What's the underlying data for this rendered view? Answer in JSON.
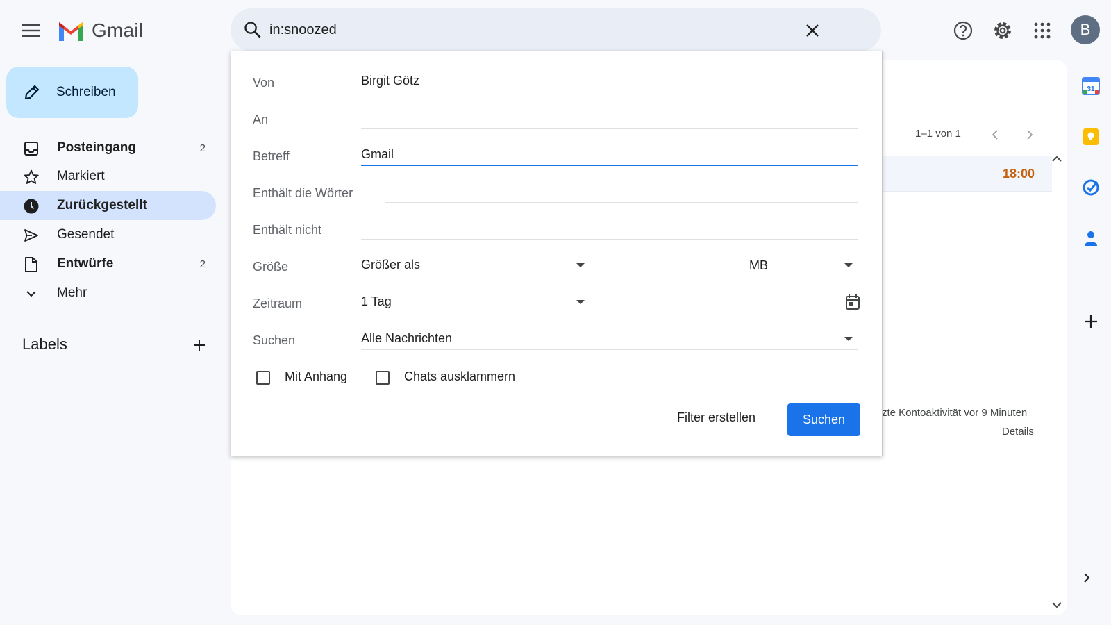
{
  "app": {
    "name": "Gmail"
  },
  "search": {
    "query": "in:snoozed"
  },
  "compose": {
    "label": "Schreiben"
  },
  "sidebar": {
    "items": [
      {
        "label": "Posteingang",
        "count": "2"
      },
      {
        "label": "Markiert",
        "count": ""
      },
      {
        "label": "Zurückgestellt",
        "count": ""
      },
      {
        "label": "Gesendet",
        "count": ""
      },
      {
        "label": "Entwürfe",
        "count": "2"
      },
      {
        "label": "Mehr",
        "count": ""
      }
    ],
    "labels_heading": "Labels"
  },
  "avatar": {
    "initial": "B"
  },
  "list": {
    "pager": "1–1 von 1",
    "row_time": "18:00",
    "activity": "zte Kontoaktivität vor 9 Minuten",
    "details": "Details"
  },
  "advanced": {
    "from_label": "Von",
    "from_value": "Birgit Götz",
    "to_label": "An",
    "to_value": "",
    "subject_label": "Betreff",
    "subject_value": "Gmail",
    "has_words_label": "Enthält die Wörter",
    "has_words_value": "",
    "not_has_label": "Enthält nicht",
    "not_has_value": "",
    "size_label": "Größe",
    "size_op": "Größer als",
    "size_value": "",
    "size_unit": "MB",
    "date_label": "Zeitraum",
    "date_range": "1 Tag",
    "date_value": "",
    "search_in_label": "Suchen",
    "search_in": "Alle Nachrichten",
    "has_attachment": "Mit Anhang",
    "exclude_chats": "Chats ausklammern",
    "create_filter": "Filter erstellen",
    "search_button": "Suchen"
  },
  "colors": {
    "accent": "#1a73e8",
    "compose_bg": "#c2e7ff",
    "active_nav": "#d3e3fd",
    "snooze_time": "#c46210"
  }
}
